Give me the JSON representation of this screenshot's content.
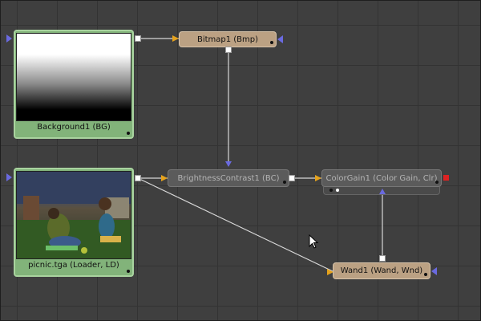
{
  "nodes": {
    "bitmap": {
      "label": "Bitmap1  (Bmp)"
    },
    "background": {
      "label": "Background1  (BG)"
    },
    "brightness": {
      "label": "BrightnessContrast1  (BC)"
    },
    "colorgain": {
      "label": "ColorGain1  (Color Gain, Clr)"
    },
    "loader": {
      "label": "picnic.tga  (Loader, LD)"
    },
    "wand": {
      "label": "Wand1  (Wand, Wnd)"
    }
  },
  "colors": {
    "canvas": "#3f3f3f",
    "tool_node": "#bba183",
    "disabled_node": "#5b5b5b",
    "media_node": "#82b37a",
    "wire": "#d8d8d8",
    "input_port": "#e5a21c",
    "mask_port": "#6a6ae0"
  }
}
